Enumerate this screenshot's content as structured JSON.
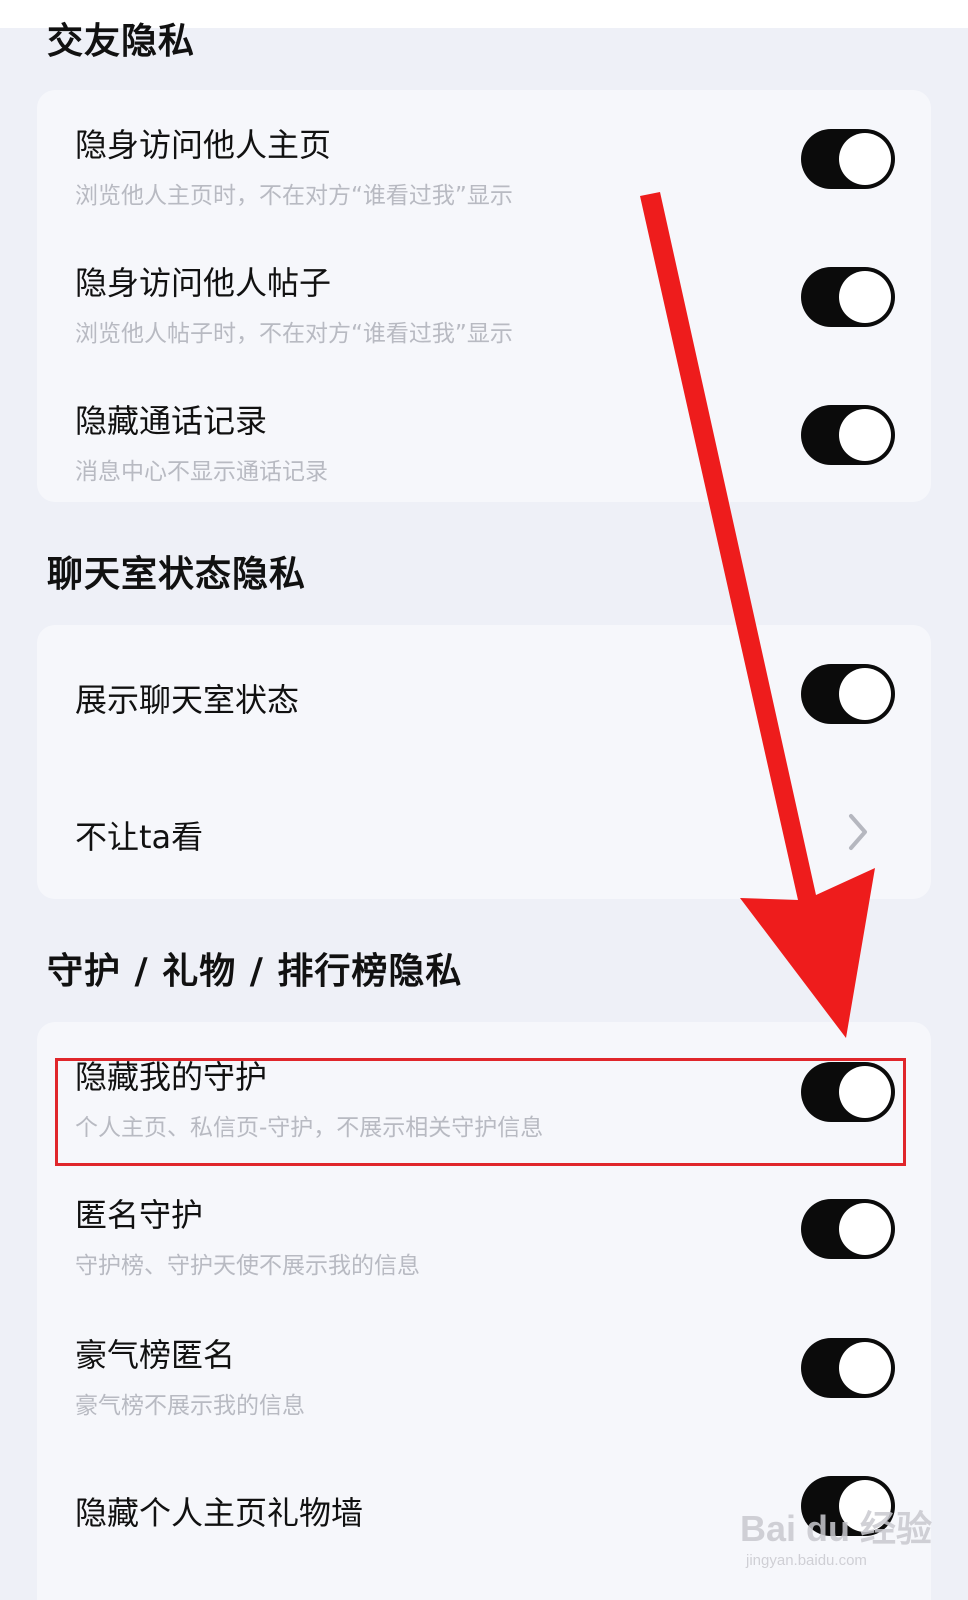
{
  "sections": [
    {
      "title": "交友隐私",
      "items": [
        {
          "label": "隐身访问他人主页",
          "sub": "浏览他人主页时，不在对方“谁看过我”显示",
          "control": "toggle",
          "on": true
        },
        {
          "label": "隐身访问他人帖子",
          "sub": "浏览他人帖子时，不在对方“谁看过我”显示",
          "control": "toggle",
          "on": true
        },
        {
          "label": "隐藏通话记录",
          "sub": "消息中心不显示通话记录",
          "control": "toggle",
          "on": true
        }
      ]
    },
    {
      "title": "聊天室状态隐私",
      "items": [
        {
          "label": "展示聊天室状态",
          "control": "toggle",
          "on": true
        },
        {
          "label": "不让ta看",
          "control": "chevron"
        }
      ]
    },
    {
      "title": "守护 / 礼物 / 排行榜隐私",
      "items": [
        {
          "label": "隐藏我的守护",
          "sub": "个人主页、私信页-守护，不展示相关守护信息",
          "control": "toggle",
          "on": true
        },
        {
          "label": "匿名守护",
          "sub": "守护榜、守护天使不展示我的信息",
          "control": "toggle",
          "on": true
        },
        {
          "label": "豪气榜匿名",
          "sub": "豪气榜不展示我的信息",
          "control": "toggle",
          "on": true
        },
        {
          "label": "隐藏个人主页礼物墙",
          "control": "toggle",
          "on": true
        }
      ]
    }
  ],
  "watermark": {
    "brand": "Bai du 经验",
    "url": "jingyan.baidu.com"
  },
  "colors": {
    "background": "#eef0f7",
    "card": "#f6f7fb",
    "toggle_on": "#0b0b0b",
    "annotation_red": "#e0262b"
  }
}
